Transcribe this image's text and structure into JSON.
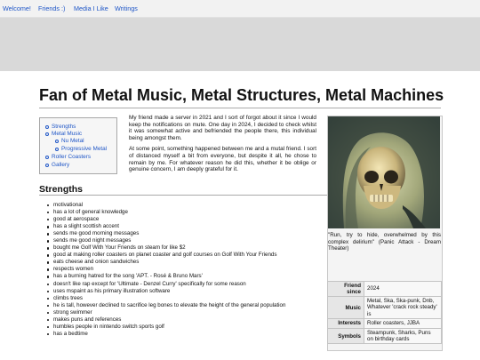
{
  "nav": {
    "items": [
      "Welcome!",
      "Friends :)",
      "Media I Like",
      "Writings"
    ]
  },
  "page_title": "Fan of Metal Music, Metal Structures, Metal Machines",
  "toc": [
    "Strengths",
    "Metal Music",
    "Nu Metal",
    "Progressive Metal",
    "Roller Coasters",
    "Gallery"
  ],
  "intro": {
    "p1": "My friend made a server in 2021 and I sort of forgot about it since I would keep the notifications on mute. One day in 2024, I decided to check whilst it was somewhat active and befriended the people there, this individual being amongst them.",
    "p2": "At some point, something happened between me and a mutal friend. I sort of distanced myself a bit from everyone, but despite it all, he chose to remain by me. For whatever reason he did this, whether it be oblige or genuine concern, I am deeply grateful for it."
  },
  "strengths": {
    "heading": "Strengths",
    "items": [
      "motivational",
      "has a lot of general knowledge",
      "good at aerospace",
      "has a slight scottish accent",
      "sends me good morning messages",
      "sends me good night messages",
      "bought me Golf With Your Friends on steam for like $2",
      "good at making roller coasters on planet coaster and golf courses on Golf With Your Friends",
      "eats cheese and onion sandwiches",
      "respects women",
      "has a burning hatred for the song 'APT. - Rosé & Bruno Mars'",
      "doesn't like rap except for 'Ultimate - Denzel Curry' specifically for some reason",
      "uses mspaint as his primary illustration software",
      "climbs trees",
      "he is tall, however declined to sacrifice leg bones to elevate the height of the general population",
      "strong swimmer",
      "makes puns and references",
      "humbles people in nintendo switch sports golf",
      "has a bedtime"
    ]
  },
  "infobox": {
    "caption": "\"Run, try to hide, overwhelmed by this complex delirium\" (Panic Attack - Dream Theater)",
    "rows": [
      {
        "label": "Friend since",
        "value": "2024"
      },
      {
        "label": "Music",
        "value": "Metal, Ska, Ska-punk, Dnb, Whatever 'crack rock steady' is"
      },
      {
        "label": "Interests",
        "value": "Roller coasters, JJBA"
      },
      {
        "label": "Symbols",
        "value": "Steampunk, Sharks, Puns on birthday cards"
      }
    ]
  },
  "colors": {
    "link": "#1f56c7",
    "banner": "#d9d9d9",
    "nav_bg": "#f2f2f2"
  }
}
